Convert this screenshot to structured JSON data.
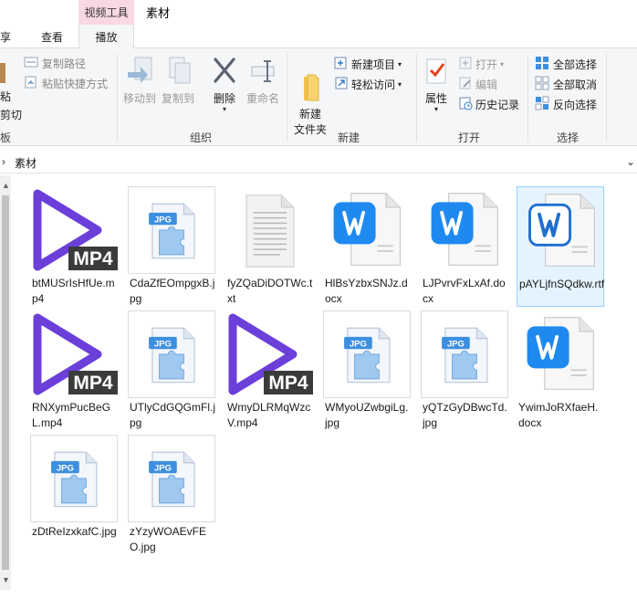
{
  "window": {
    "context_tab": "视频工具",
    "folder_title": "素材"
  },
  "tabs": {
    "share": "享",
    "view": "查看",
    "play": "播放"
  },
  "ribbon": {
    "clipboard": {
      "paste": "粘",
      "cut": "剪切",
      "copy_path": "复制路径",
      "paste_shortcut": "粘贴快捷方式",
      "label": "板"
    },
    "organize": {
      "move_to": "移动到",
      "copy_to": "复制到",
      "delete": "删除",
      "rename": "重命名",
      "label": "组织"
    },
    "new": {
      "new_folder": "新建\n文件夹",
      "new_item": "新建项目",
      "easy_access": "轻松访问",
      "label": "新建"
    },
    "open": {
      "properties": "属性",
      "open": "打开",
      "edit": "编辑",
      "history": "历史记录",
      "label": "打开"
    },
    "select": {
      "select_all": "全部选择",
      "select_none": "全部取消",
      "invert": "反向选择",
      "label": "选择"
    }
  },
  "address": {
    "crumb": "素材"
  },
  "accent": {
    "mp4_purple": "#6b3fd9",
    "word_blue": "#1e8af0",
    "selection": "#cce8ff"
  },
  "files": [
    {
      "name": "btMUSrIsHfUe.mp4",
      "type": "mp4"
    },
    {
      "name": "CdaZfEOmpgxB.jpg",
      "type": "jpg"
    },
    {
      "name": "fyZQaDiDOTWc.txt",
      "type": "txt"
    },
    {
      "name": "HlBsYzbxSNJz.docx",
      "type": "docx"
    },
    {
      "name": "LJPvrvFxLxAf.docx",
      "type": "docx"
    },
    {
      "name": "pAYLjfnSQdkw.rtf",
      "type": "rtf"
    },
    {
      "name": "RNXymPucBeGL.mp4",
      "type": "mp4"
    },
    {
      "name": "UTlyCdGQGmFl.jpg",
      "type": "jpg"
    },
    {
      "name": "WmyDLRMqWzcV.mp4",
      "type": "mp4"
    },
    {
      "name": "WMyoUZwbgiLg.jpg",
      "type": "jpg"
    },
    {
      "name": "yQTzGyDBwcTd.jpg",
      "type": "jpg"
    },
    {
      "name": "YwimJoRXfaeH.docx",
      "type": "docx"
    },
    {
      "name": "zDtReIzxkafC.jpg",
      "type": "jpg"
    },
    {
      "name": "zYzyWOAEvFEO.jpg",
      "type": "jpg"
    }
  ],
  "icons": {
    "mp4_badge": "MP4",
    "jpg_badge": "JPG"
  }
}
